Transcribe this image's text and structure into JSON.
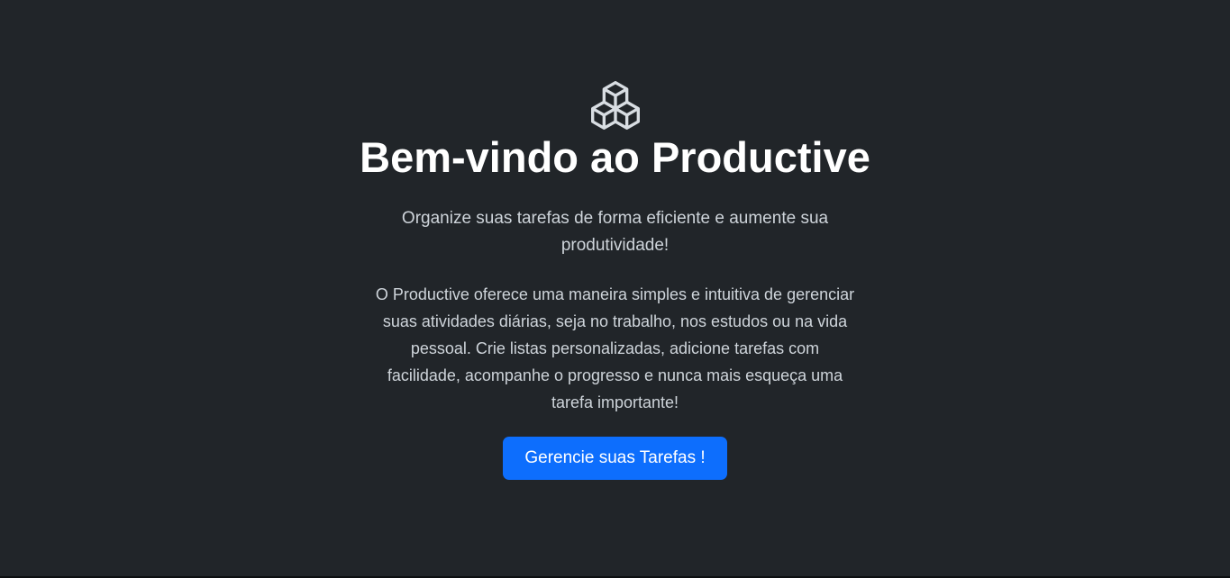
{
  "hero": {
    "icon": "boxes-icon",
    "title": "Bem-vindo ao Productive",
    "lead": "Organize suas tarefas de forma eficiente e aumente sua produtividade!",
    "description": "O Productive oferece uma maneira simples e intuitiva de gerenciar suas atividades diárias, seja no trabalho, nos estudos ou na vida pessoal. Crie listas personalizadas, adicione tarefas com facilidade, acompanhe o progresso e nunca mais esqueça uma tarefa importante!",
    "cta_label": "Gerencie suas Tarefas !"
  },
  "colors": {
    "background": "#212529",
    "title": "#ffffff",
    "body_text": "#ced4da",
    "accent": "#0d6efd"
  }
}
